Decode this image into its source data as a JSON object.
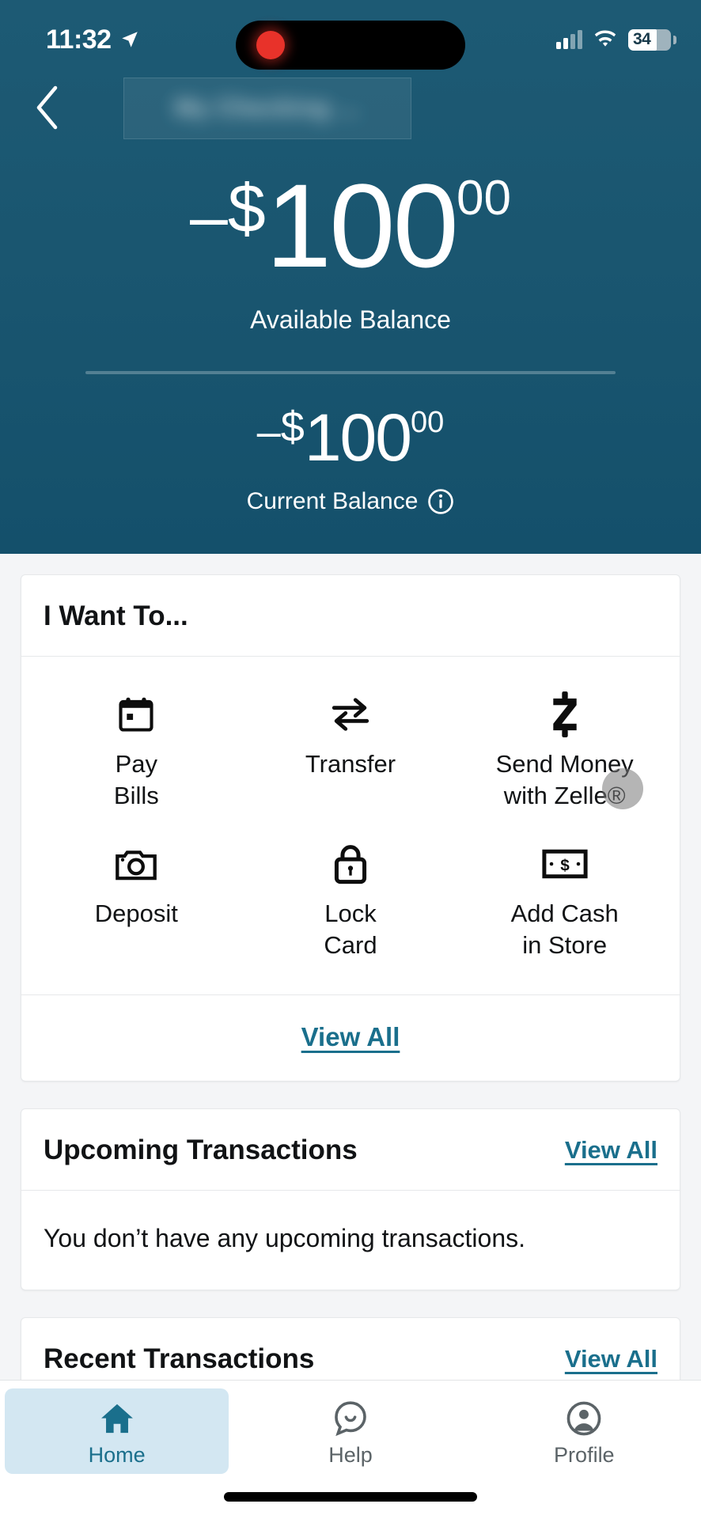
{
  "statusbar": {
    "time": "11:32",
    "battery_level": "34",
    "location_icon": "location-arrow-icon",
    "signal_icon": "cellular-signal-icon",
    "wifi_icon": "wifi-icon",
    "recording_indicator": "screen-recording-dot"
  },
  "header": {
    "back_icon": "chevron-left-icon",
    "account_name_masked": "My Checking  ...",
    "available": {
      "sign": "–",
      "currency": "$",
      "whole": "100",
      "cents": "00",
      "label": "Available Balance"
    },
    "current": {
      "sign": "–",
      "currency": "$",
      "whole": "100",
      "cents": "00",
      "label": "Current Balance",
      "info_icon": "info-circle-icon"
    },
    "background_color": "#1a5670"
  },
  "i_want_to": {
    "title": "I Want To...",
    "actions": [
      {
        "label": "Pay\nBills",
        "label_line1": "Pay",
        "label_line2": "Bills",
        "icon": "calendar-icon"
      },
      {
        "label": "Transfer",
        "label_line1": "Transfer",
        "label_line2": "",
        "icon": "transfer-arrows-icon"
      },
      {
        "label": "Send Money with Zelle®",
        "label_line1": "Send Money",
        "label_line2": "with Zelle®",
        "icon": "zelle-logo-icon"
      },
      {
        "label": "Deposit",
        "label_line1": "Deposit",
        "label_line2": "",
        "icon": "camera-icon"
      },
      {
        "label": "Lock Card",
        "label_line1": "Lock",
        "label_line2": "Card",
        "icon": "padlock-icon"
      },
      {
        "label": "Add Cash in Store",
        "label_line1": "Add Cash",
        "label_line2": "in Store",
        "icon": "banknote-icon"
      }
    ],
    "view_all_label": "View All"
  },
  "upcoming": {
    "title": "Upcoming Transactions",
    "view_all_label": "View All",
    "empty_message": "You don’t have any upcoming transactions."
  },
  "recent": {
    "title": "Recent Transactions",
    "view_all_label": "View All"
  },
  "tabbar": {
    "tabs": [
      {
        "label": "Home",
        "icon": "home-icon",
        "active": true
      },
      {
        "label": "Help",
        "icon": "chat-bubble-icon",
        "active": false
      },
      {
        "label": "Profile",
        "icon": "person-circle-icon",
        "active": false
      }
    ]
  },
  "colors": {
    "header_teal": "#1a5670",
    "link_teal": "#1a6f8c",
    "active_tab_bg": "#d3e7f2",
    "page_bg": "#f4f5f7"
  }
}
